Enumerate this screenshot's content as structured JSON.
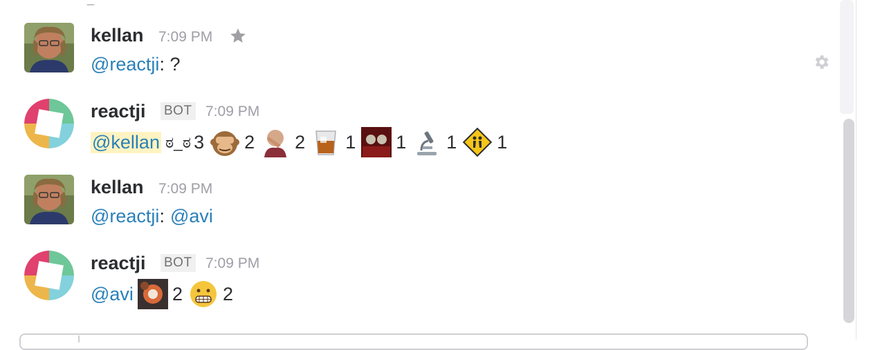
{
  "messages": [
    {
      "user": "kellan",
      "time": "7:09 PM",
      "bot": false,
      "text_mention": "@reactji",
      "text_rest": ": ?",
      "starred": false
    },
    {
      "user": "reactji",
      "time": "7:09 PM",
      "bot": true,
      "bot_label": "BOT",
      "mention": "@kellan",
      "reactions": [
        {
          "emoji": "ಠ_ಠ",
          "count": "3"
        },
        {
          "emoji": "see-no-evil-monkey",
          "count": "2"
        },
        {
          "emoji": "facepalm",
          "count": "2"
        },
        {
          "emoji": "whiskey-glass",
          "count": "1"
        },
        {
          "emoji": "muppets-balcony",
          "count": "1"
        },
        {
          "emoji": "microscope",
          "count": "1"
        },
        {
          "emoji": "children-crossing",
          "count": "1"
        }
      ]
    },
    {
      "user": "kellan",
      "time": "7:09 PM",
      "bot": false,
      "text_mention": "@reactji",
      "text_sep": ":",
      "text_mention2": "@avi"
    },
    {
      "user": "reactji",
      "time": "7:09 PM",
      "bot": true,
      "bot_label": "BOT",
      "mention": "@avi",
      "reactions": [
        {
          "emoji": "custom-flower",
          "count": "2"
        },
        {
          "emoji": "grimacing",
          "count": "2"
        }
      ]
    }
  ],
  "colors": {
    "mention": "#2a80b9",
    "mention_highlight": "#fff3c2",
    "timestamp": "#9e9ea6"
  }
}
